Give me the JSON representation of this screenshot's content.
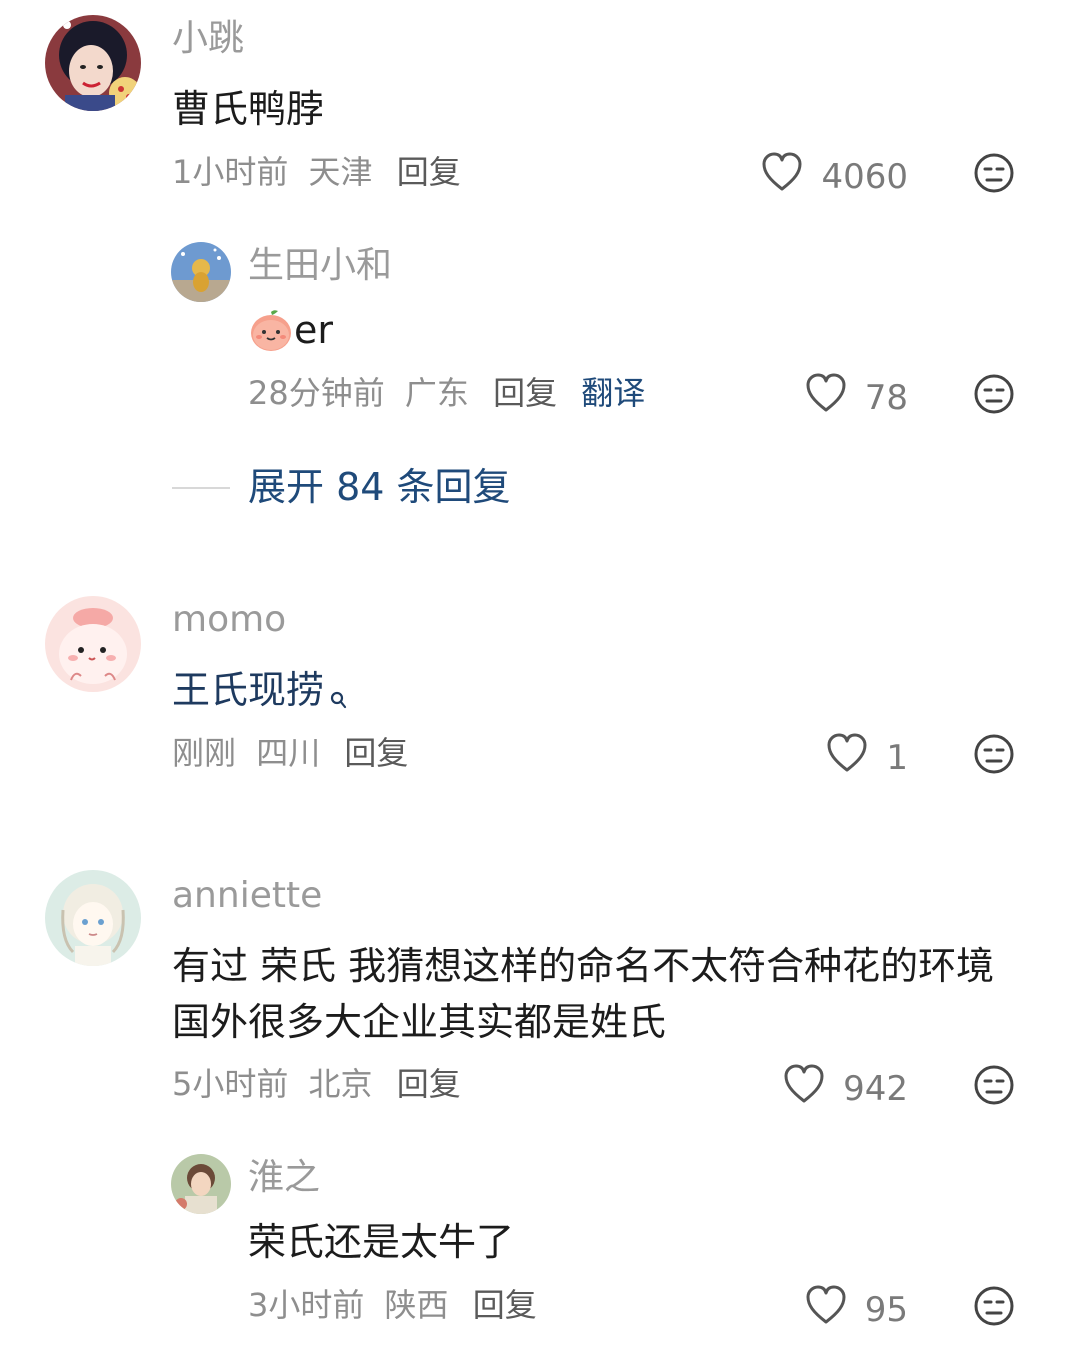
{
  "comments": [
    {
      "user": "小跳",
      "content": "曹氏鸭脖",
      "time": "1小时前",
      "location": "天津",
      "reply_label": "回复",
      "likes": "4060",
      "replies": [
        {
          "user": "生田小和",
          "content_text": "er",
          "time": "28分钟前",
          "location": "广东",
          "reply_label": "回复",
          "translate_label": "翻译",
          "likes": "78"
        }
      ],
      "expand_label": "展开 84 条回复"
    },
    {
      "user": "momo",
      "content": "王氏现捞",
      "content_search_icon": "search-icon",
      "time": "刚刚",
      "location": "四川",
      "reply_label": "回复",
      "likes": "1"
    },
    {
      "user": "anniette",
      "content": "有过 荣氏 我猜想这样的命名不太符合种花的环境 国外很多大企业其实都是姓氏",
      "time": "5小时前",
      "location": "北京",
      "reply_label": "回复",
      "likes": "942",
      "replies": [
        {
          "user": "淮之",
          "content": "荣氏还是太牛了",
          "time": "3小时前",
          "location": "陕西",
          "reply_label": "回复",
          "likes": "95"
        }
      ]
    }
  ],
  "icons": {
    "like": "heart-outline-icon",
    "react": "neutral-face-icon",
    "emoji": "peach-face-emoji"
  },
  "colors": {
    "link": "#1f4a7a",
    "username": "#9a9a9a",
    "text": "#1c1c1c",
    "meta": "#8e8e8e"
  }
}
